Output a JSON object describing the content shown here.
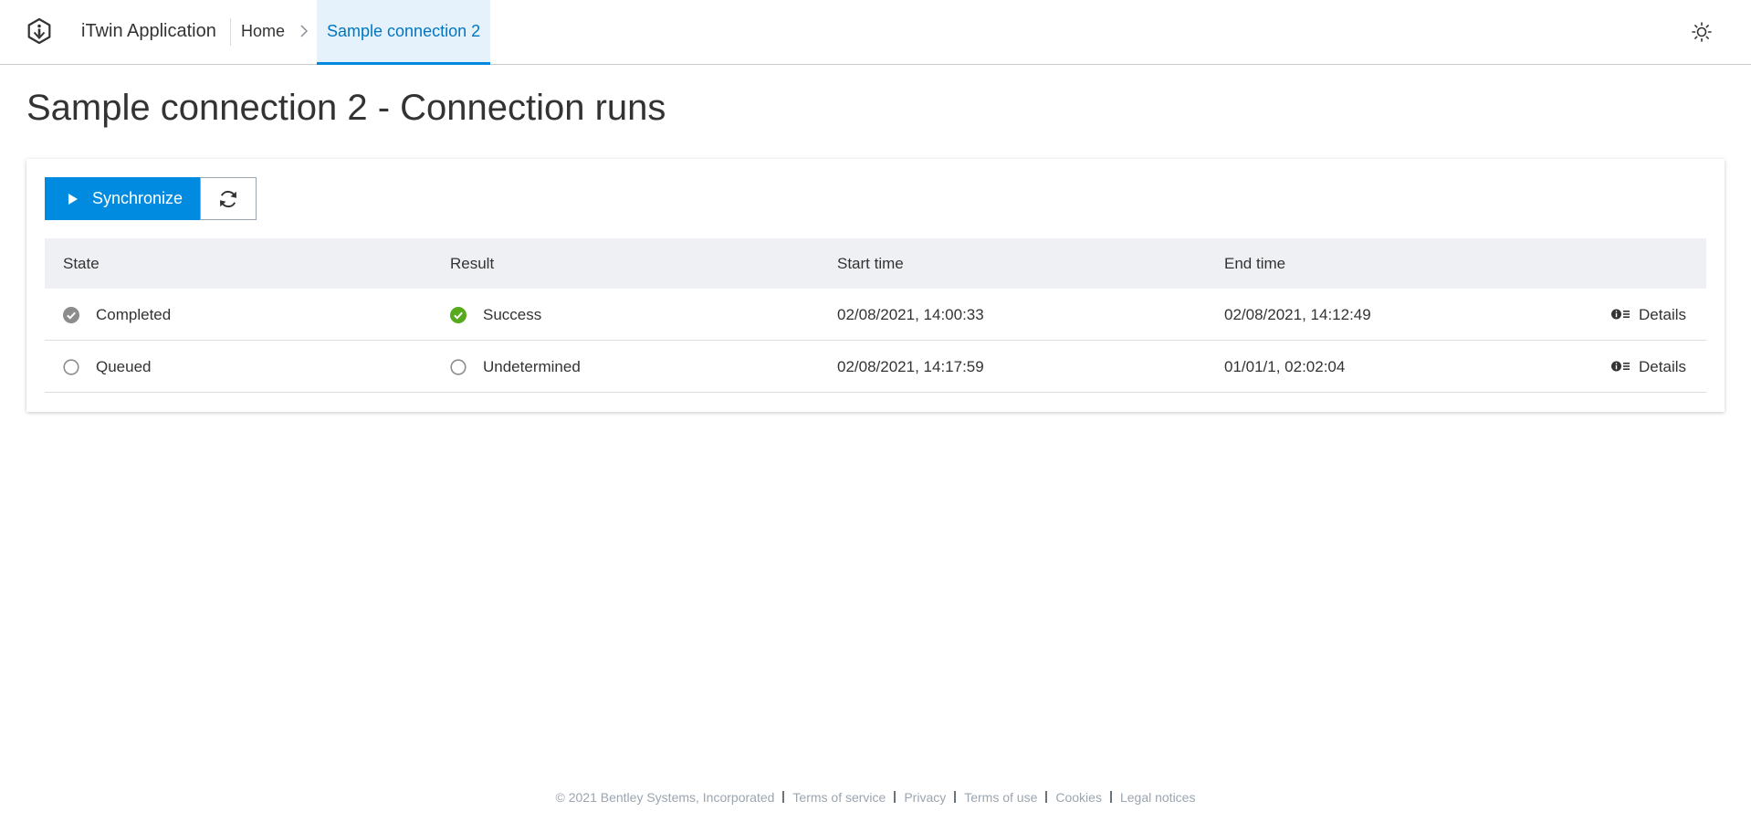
{
  "header": {
    "app_title": "iTwin Application",
    "breadcrumb": {
      "home": "Home",
      "current": "Sample connection 2"
    }
  },
  "page": {
    "title": "Sample connection 2 - Connection runs"
  },
  "toolbar": {
    "synchronize_label": "Synchronize"
  },
  "table": {
    "columns": [
      "State",
      "Result",
      "Start time",
      "End time"
    ],
    "rows": [
      {
        "state": "Completed",
        "state_icon": "completed-check-icon",
        "result": "Success",
        "result_icon": "success-check-icon",
        "start_time": "02/08/2021, 14:00:33",
        "end_time": "02/08/2021, 14:12:49",
        "details_label": "Details"
      },
      {
        "state": "Queued",
        "state_icon": "empty-circle-icon",
        "result": "Undetermined",
        "result_icon": "empty-circle-icon",
        "start_time": "02/08/2021, 14:17:59",
        "end_time": "01/01/1, 02:02:04",
        "details_label": "Details"
      }
    ]
  },
  "footer": {
    "copyright": "© 2021 Bentley Systems, Incorporated",
    "links": [
      "Terms of service",
      "Privacy",
      "Terms of use",
      "Cookies",
      "Legal notices"
    ]
  },
  "colors": {
    "accent": "#008be1",
    "active_tab_bg": "#e5f2fb",
    "active_tab_text": "#0076c2",
    "success": "#56aa1c",
    "neutral_icon": "#8c8c8c"
  }
}
